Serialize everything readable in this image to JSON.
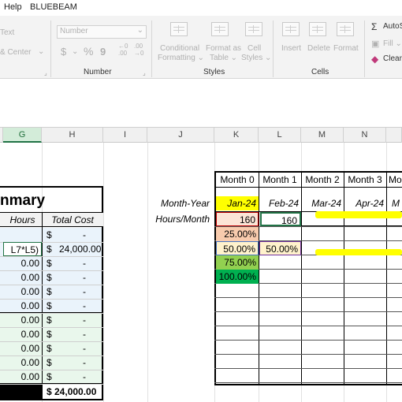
{
  "menu": {
    "help": "Help",
    "bluebeam": "BLUEBEAM"
  },
  "ribbon": {
    "alignment": {
      "text_fragment": "Text",
      "merge_center": "& Center",
      "merge_arrow": "⌄"
    },
    "number": {
      "format_value": "Number",
      "currency": "$",
      "percent": "%",
      "comma": "9",
      "inc_decimal": "←0 .00",
      "dec_decimal": ".00 →0",
      "group_label": "Number"
    },
    "styles": {
      "conditional": [
        "Conditional",
        "Formatting ⌄"
      ],
      "format_table": [
        "Format as",
        "Table ⌄"
      ],
      "cell_styles": [
        "Cell",
        "Styles ⌄"
      ],
      "group_label": "Styles"
    },
    "cells": {
      "insert": "Insert",
      "delete": "Delete",
      "format": "Format",
      "group_label": "Cells"
    },
    "editing": {
      "autosum": "AutoS",
      "fill": "Fill ⌄",
      "clear": "Clear"
    }
  },
  "columns": [
    "G",
    "H",
    "I",
    "J",
    "K",
    "L",
    "M",
    "N"
  ],
  "summary": {
    "title_fragment": "nmary",
    "hours_header": "Hours",
    "total_cost_header": "Total Cost",
    "rows": [
      {
        "hours": "",
        "cost_sym": "$",
        "cost": "-"
      },
      {
        "hours": "L7*L5)",
        "cost_sym": "$",
        "cost": "24,000.00"
      },
      {
        "hours": "0.00",
        "cost_sym": "$",
        "cost": "-"
      },
      {
        "hours": "0.00",
        "cost_sym": "$",
        "cost": "-"
      },
      {
        "hours": "0.00",
        "cost_sym": "$",
        "cost": "-"
      },
      {
        "hours": "0.00",
        "cost_sym": "$",
        "cost": "-"
      },
      {
        "hours": "0.00",
        "cost_sym": "$",
        "cost": "-"
      },
      {
        "hours": "0.00",
        "cost_sym": "$",
        "cost": "-"
      },
      {
        "hours": "0.00",
        "cost_sym": "$",
        "cost": "-"
      },
      {
        "hours": "0.00",
        "cost_sym": "$",
        "cost": "-"
      },
      {
        "hours": "0.00",
        "cost_sym": "$",
        "cost": "-"
      }
    ],
    "total": "$ 24,000.00"
  },
  "schedule": {
    "row_labels": {
      "month_year": "Month-Year",
      "hours_month": "Hours/Month"
    },
    "month_headers": [
      "Month 0",
      "Month 1",
      "Month 2",
      "Month 3",
      "Mo"
    ],
    "month_years": [
      "Jan-24",
      "Feb-24",
      "Mar-24",
      "Apr-24",
      "M"
    ],
    "hours": [
      "160",
      "160"
    ],
    "pct_k": [
      "25.00%",
      "50.00%",
      "75.00%",
      "100.00%"
    ],
    "pct_l": "50.00%"
  },
  "colors": {
    "excel_green": "#217346",
    "highlight_yellow": "#ffff00"
  }
}
